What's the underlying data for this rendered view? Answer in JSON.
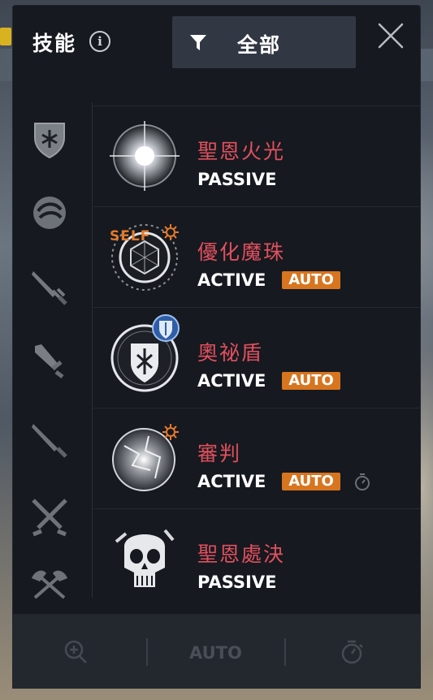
{
  "header": {
    "title": "技能",
    "info_icon": "info-icon",
    "filter_label": "全部",
    "filter_icon": "filter-icon",
    "close_icon": "close-icon"
  },
  "sidebar": {
    "categories": [
      {
        "icon": "shield-emblem-icon"
      },
      {
        "icon": "orb-rune-icon"
      },
      {
        "icon": "short-sword-icon"
      },
      {
        "icon": "broad-sword-icon"
      },
      {
        "icon": "serrated-blade-icon"
      },
      {
        "icon": "crossed-swords-icon"
      },
      {
        "icon": "crossed-axes-icon"
      }
    ]
  },
  "skills": [
    {
      "name": "聖恩火光",
      "type": "PASSIVE",
      "auto": false,
      "icon": "holy-light-icon"
    },
    {
      "name": "優化魔珠",
      "type": "ACTIVE",
      "auto": true,
      "auto_label": "AUTO",
      "self_tag": "SELF",
      "icon": "magic-orb-icon"
    },
    {
      "name": "奧祕盾",
      "type": "ACTIVE",
      "auto": true,
      "auto_label": "AUTO",
      "icon": "arcane-shield-icon"
    },
    {
      "name": "審判",
      "type": "ACTIVE",
      "auto": true,
      "auto_label": "AUTO",
      "icon": "judgment-orb-icon",
      "timer_icon": "stopwatch-icon"
    },
    {
      "name": "聖恩處決",
      "type": "PASSIVE",
      "auto": false,
      "icon": "execution-skull-icon"
    }
  ],
  "footer": {
    "zoom_icon": "zoom-in-icon",
    "auto_label": "AUTO",
    "timer_icon": "stopwatch-icon"
  },
  "colors": {
    "panel_bg": "#16191f",
    "skill_name": "#e0505e",
    "auto_badge": "#d8751f",
    "footer_bg": "#23272e"
  }
}
